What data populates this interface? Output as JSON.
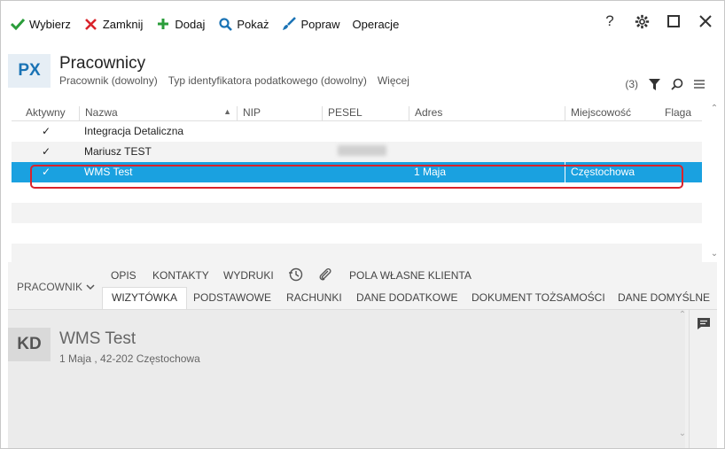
{
  "toolbar": {
    "wybierz": "Wybierz",
    "zamknij": "Zamknij",
    "dodaj": "Dodaj",
    "pokaz": "Pokaż",
    "popraw": "Popraw",
    "operacje": "Operacje"
  },
  "window_controls": {
    "help": "?"
  },
  "header": {
    "badge": "PX",
    "title": "Pracownicy",
    "filters": [
      "Pracownik (dowolny)",
      "Typ identyfikatora podatkowego (dowolny)",
      "Więcej"
    ],
    "count": "(3)"
  },
  "grid": {
    "columns": [
      "Aktywny",
      "Nazwa",
      "NIP",
      "PESEL",
      "Adres",
      "Miejscowość",
      "Flaga"
    ],
    "rows": [
      {
        "aktywny": "✓",
        "nazwa": "Integracja Detaliczna",
        "adres": "",
        "miejscowosc": ""
      },
      {
        "aktywny": "✓",
        "nazwa": "Mariusz TEST",
        "adres": "",
        "miejscowosc": ""
      },
      {
        "aktywny": "✓",
        "nazwa": "WMS Test",
        "adres": "1 Maja",
        "miejscowosc": "Częstochowa"
      }
    ]
  },
  "bottom": {
    "pracownik": "PRACOWNIK",
    "tabs_top": [
      "OPIS",
      "KONTAKTY",
      "WYDRUKI",
      "POLA WŁASNE KLIENTA"
    ],
    "tabs_bottom": [
      "WIZYTÓWKA",
      "PODSTAWOWE",
      "RACHUNKI",
      "DANE DODATKOWE",
      "DOKUMENT TOŻSAMOŚCI",
      "DANE DOMYŚLNE"
    ],
    "card": {
      "badge": "KD",
      "name": "WMS Test",
      "address": "1 Maja , 42-202 Częstochowa"
    }
  },
  "colors": {
    "accent": "#1aa1e0",
    "highlight": "#d9232b",
    "brand_blue": "#1a73b5"
  }
}
